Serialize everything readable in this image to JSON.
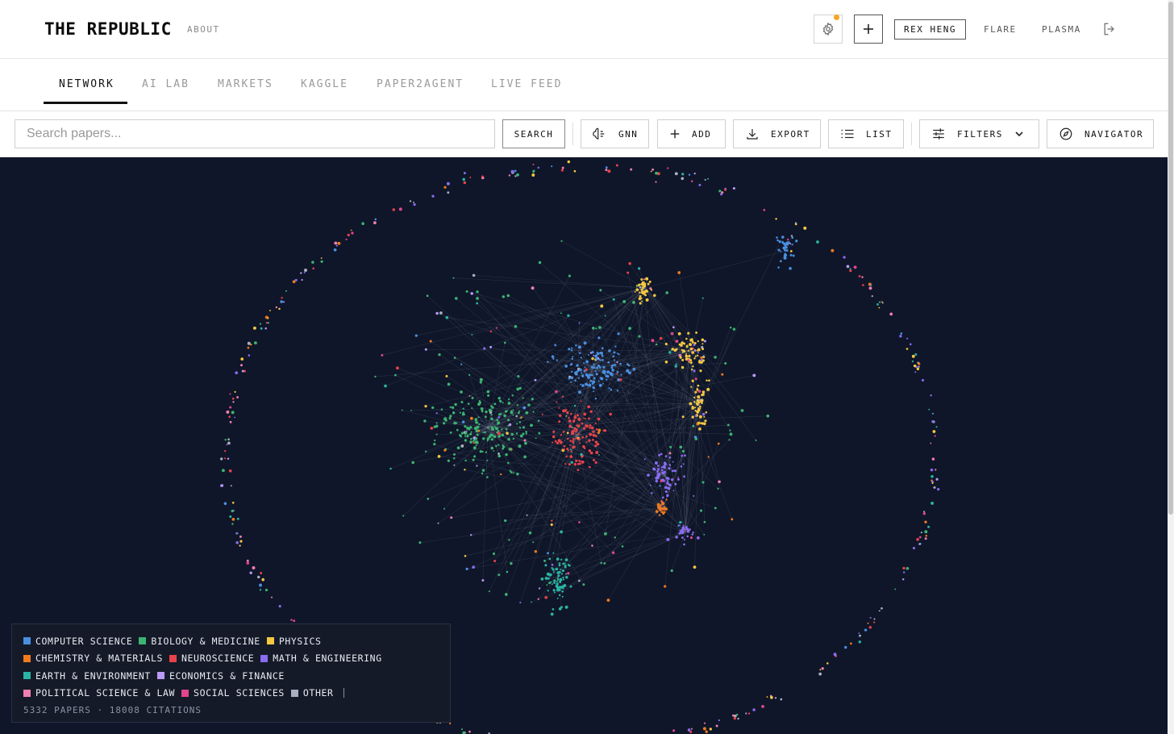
{
  "header": {
    "brand": "THE REPUBLIC",
    "about": "ABOUT",
    "user": "REX HENG",
    "links": [
      "FLARE",
      "PLASMA"
    ],
    "notification_color": "#f5a623"
  },
  "tabs": [
    {
      "label": "NETWORK",
      "active": true
    },
    {
      "label": "AI LAB"
    },
    {
      "label": "MARKETS"
    },
    {
      "label": "KAGGLE"
    },
    {
      "label": "PAPER2AGENT"
    },
    {
      "label": "LIVE FEED"
    }
  ],
  "toolbar": {
    "search_placeholder": "Search papers...",
    "search_label": "SEARCH",
    "gnn_label": "GNN",
    "add_label": "ADD",
    "export_label": "EXPORT",
    "list_label": "LIST",
    "filters_label": "FILTERS",
    "navigator_label": "NAVIGATOR"
  },
  "legend": {
    "categories": [
      {
        "name": "COMPUTER SCIENCE",
        "color": "#4a90e2"
      },
      {
        "name": "BIOLOGY & MEDICINE",
        "color": "#3cb371"
      },
      {
        "name": "PHYSICS",
        "color": "#f5c842"
      },
      {
        "name": "CHEMISTRY & MATERIALS",
        "color": "#f07a1e"
      },
      {
        "name": "NEUROSCIENCE",
        "color": "#e8424a"
      },
      {
        "name": "MATH & ENGINEERING",
        "color": "#8a6cf0"
      },
      {
        "name": "EARTH & ENVIRONMENT",
        "color": "#2bb3a3"
      },
      {
        "name": "ECONOMICS & FINANCE",
        "color": "#b99af5"
      },
      {
        "name": "POLITICAL SCIENCE & LAW",
        "color": "#f07fb0"
      },
      {
        "name": "SOCIAL SCIENCES",
        "color": "#e0458f"
      },
      {
        "name": "OTHER",
        "color": "#a9b0c0"
      }
    ],
    "stats": "5332 PAPERS · 18008 CITATIONS"
  },
  "graph": {
    "background": "#0f1629"
  }
}
